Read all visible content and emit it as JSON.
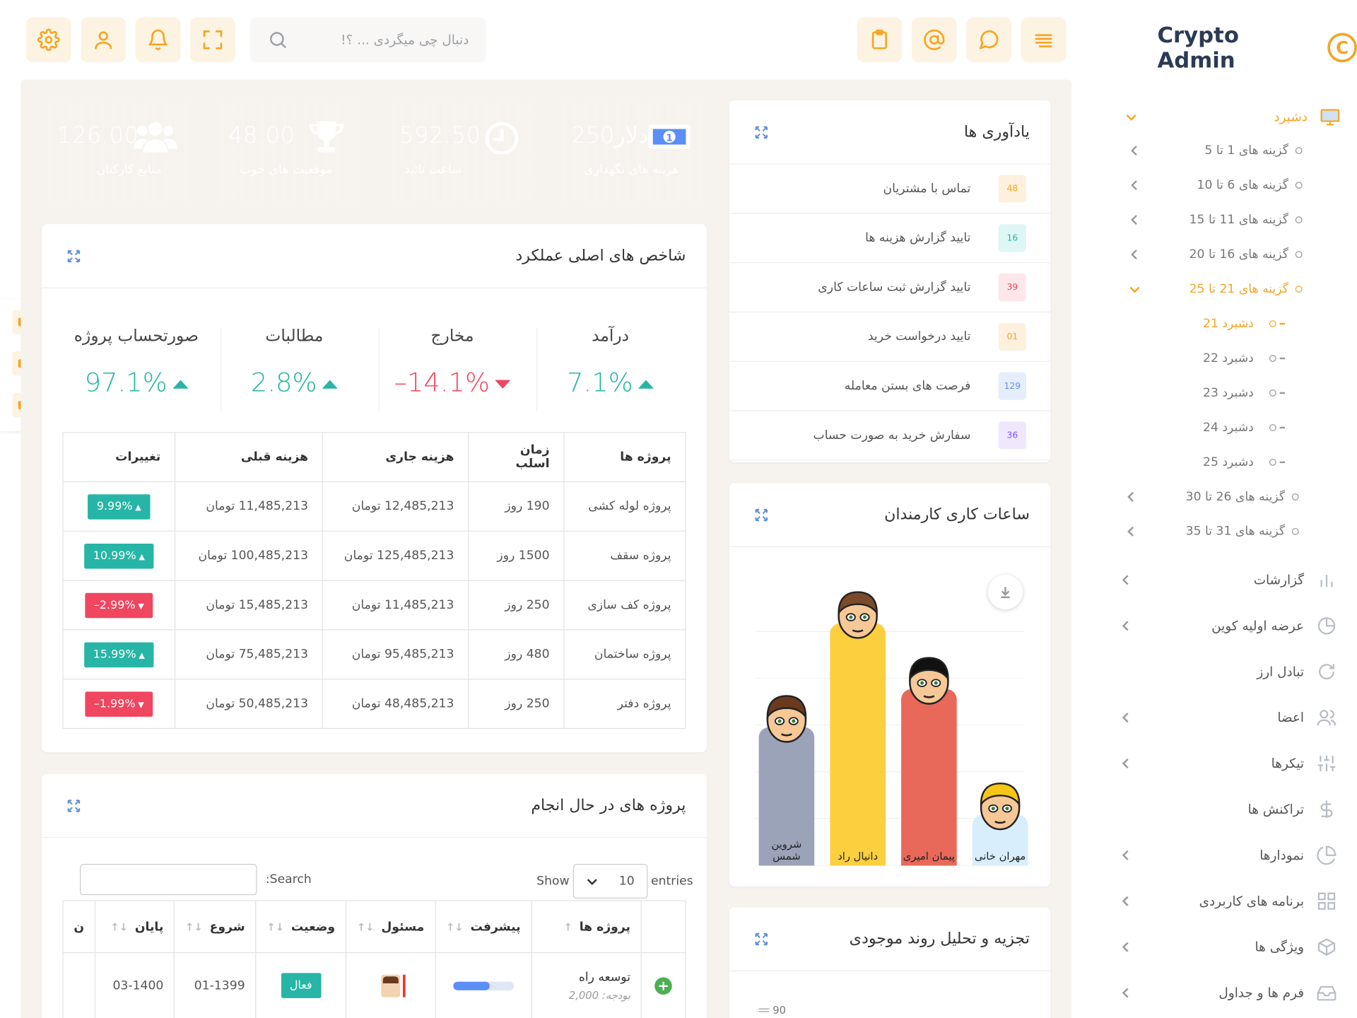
{
  "header": {
    "logo": "Crypto Admin",
    "logo_glyph": "C",
    "search_placeholder": "دنبال چی میگردی ... ؟!",
    "left_icons": [
      "gear-icon",
      "user-icon",
      "bell-icon",
      "fullscreen-icon"
    ],
    "right_icons": [
      "clipboard-icon",
      "at-icon",
      "chat-icon",
      "menu-icon"
    ]
  },
  "tiles": [
    {
      "value": "126.00",
      "label": "منابع کارکنان",
      "color": "#7b4dfb",
      "icon": "users-icon"
    },
    {
      "value": "48.00",
      "label": "موقعیت های خوب",
      "color": "#24c4b4",
      "icon": "trophy-icon"
    },
    {
      "value": "592.50",
      "label": "ساعت تائید",
      "color": "#f64b5e",
      "icon": "clock-icon"
    },
    {
      "value": "250دلار",
      "label": "هزینه های نگهداری",
      "color": "#5b8ef7",
      "icon": "banknote-icon"
    }
  ],
  "kpi": {
    "title": "شاخص های اصلی عملکرد",
    "items": [
      {
        "label": "صورتحساب پروژه",
        "value": "97.1%",
        "trend": "up"
      },
      {
        "label": "مطالبات",
        "value": "2.8%",
        "trend": "up"
      },
      {
        "label": "مخارج",
        "value": "–14.1%",
        "trend": "down"
      },
      {
        "label": "درآمد",
        "value": "7.1%",
        "trend": "up"
      }
    ],
    "columns": [
      "پروژه ها",
      "زمان اسلب",
      "هزینه جاری",
      "هزینه قبلی",
      "تغییرات"
    ],
    "rows": [
      {
        "project": "پروژه لوله کشی",
        "time": "190 روز",
        "current": "12,485,213 تومان",
        "previous": "11,485,213 تومان",
        "change": "9.99%",
        "trend": "up"
      },
      {
        "project": "پروژه سقف",
        "time": "1500 روز",
        "current": "125,485,213 تومان",
        "previous": "100,485,213 تومان",
        "change": "10.99%",
        "trend": "up"
      },
      {
        "project": "پروژه کف سازی",
        "time": "250 روز",
        "current": "11,485,213 تومان",
        "previous": "15,485,213 تومان",
        "change": "–2.99%",
        "trend": "down"
      },
      {
        "project": "پروژه ساختمان",
        "time": "480 روز",
        "current": "95,485,213 تومان",
        "previous": "75,485,213 تومان",
        "change": "15.99%",
        "trend": "up"
      },
      {
        "project": "پروژه دفتر",
        "time": "250 روز",
        "current": "48,485,213 تومان",
        "previous": "50,485,213 تومان",
        "change": "–1.99%",
        "trend": "down"
      }
    ]
  },
  "reminders": {
    "title": "یادآوری ها",
    "items": [
      {
        "count": "48",
        "text": "تماس با مشتریان",
        "bg": "#fdf1de",
        "fg": "#f5a623"
      },
      {
        "count": "16",
        "text": "تایید گزارش هزینه ها",
        "bg": "#def6f4",
        "fg": "#26b5a6"
      },
      {
        "count": "39",
        "text": "تایید گزارش ثبت ساعات کاری",
        "bg": "#fde7ea",
        "fg": "#f0465f"
      },
      {
        "count": "01",
        "text": "تایید درخواست خرید",
        "bg": "#fdf1de",
        "fg": "#f5a623"
      },
      {
        "count": "129",
        "text": "فرصت های بستن معامله",
        "bg": "#e6eefc",
        "fg": "#5b8ef7"
      },
      {
        "count": "36",
        "text": "سفارش خرید به صورت حساب",
        "bg": "#efe8fd",
        "fg": "#7b4dfb"
      }
    ]
  },
  "employees": {
    "title": "ساعات کاری کارمندان",
    "people": [
      {
        "name": "شروین شمس",
        "hours_fraction": 0.57,
        "color": "#9aa3b8",
        "hair": "#6b3a1e"
      },
      {
        "name": "دانیال راد",
        "hours_fraction": 1.0,
        "color": "#fccf3e",
        "hair": "#7a4a2a"
      },
      {
        "name": "پیمان امیری",
        "hours_fraction": 0.73,
        "color": "#e8685a",
        "hair": "#111111"
      },
      {
        "name": "مهران خانی",
        "hours_fraction": 0.21,
        "color": "#d8eefc",
        "hair": "#f5c518"
      }
    ]
  },
  "projects": {
    "title": "پروژه های در حال انجام",
    "show_label": "Show",
    "entries_value": "10",
    "entries_label": "entries",
    "search_label": ":Search",
    "columns": [
      "پروژه ها",
      "پیشرفت",
      "مسئول",
      "وضعیت",
      "شروع",
      "پایان",
      "ن"
    ],
    "rows": [
      {
        "name": "توسعه راه",
        "budget": "بودجه: 2,000",
        "status": "فعال",
        "start": "01-1399",
        "end": "03-1400",
        "progress": 0.6
      }
    ]
  },
  "trend": {
    "title": "تجزیه و تحلیل روند موجودی",
    "axis_label": "90"
  },
  "sidebar": {
    "dashboard": "دشبرد",
    "subitems": [
      "گزینه های 1 تا 5",
      "گزینه های 6 تا 10",
      "گزینه های 11 تا 15",
      "گزینه های 16 تا 20",
      "گزینه های 21 تا 25"
    ],
    "nested": [
      "دشبرد 21",
      "دشبرد 22",
      "دشبرد 23",
      "دشبرد 24",
      "دشبرد 25"
    ],
    "subitems2": [
      "گزینه های 26 تا 30",
      "گزینه های 31 تا 35"
    ],
    "menu": [
      {
        "label": "گزارشات",
        "icon": "bar-chart-icon"
      },
      {
        "label": "عرضه اولیه کوین",
        "icon": "pie-icon"
      },
      {
        "label": "تبادل ارز",
        "icon": "refresh-icon"
      },
      {
        "label": "اعضا",
        "icon": "users-icon"
      },
      {
        "label": "تیکرها",
        "icon": "sliders-icon"
      },
      {
        "label": "تراکنش ها",
        "icon": "dollar-icon"
      },
      {
        "label": "نمودارها",
        "icon": "pie-chart-icon"
      },
      {
        "label": "برنامه های کاربردی",
        "icon": "grid-icon"
      },
      {
        "label": "ویژگی ها",
        "icon": "box-icon"
      },
      {
        "label": "فرم ها و جداول",
        "icon": "inbox-icon"
      }
    ]
  },
  "colors": {
    "accent": "#f5a623",
    "teal": "#26b5a6",
    "red": "#f0465f"
  }
}
